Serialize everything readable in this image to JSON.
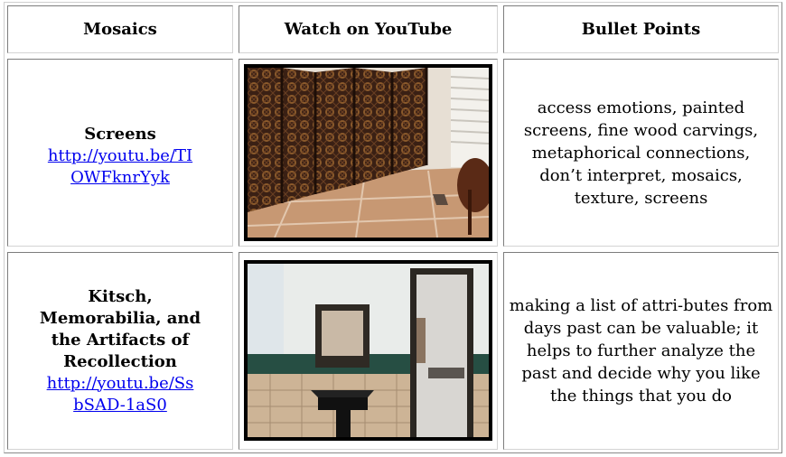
{
  "headers": {
    "col1": "Mosaics",
    "col2": "Watch on YouTube",
    "col3": "Bullet Points"
  },
  "rows": [
    {
      "title": "Screens",
      "link_line1": "http://youtu.be/TI",
      "link_line2": "OWFknrYyk",
      "bullets": "access emotions, painted screens, fine wood carvings, metaphorical connections, don’t interpret, mosaics, texture, screens"
    },
    {
      "title_line1": "Kitsch,",
      "title_line2": "Memorabilia, and",
      "title_line3": "the Artifacts of",
      "title_line4": "Recollection",
      "link_line1": "http://youtu.be/Ss",
      "link_line2": "bSAD-1aS0",
      "bullets": "making a list of attri-butes from days past can be valuable; it helps to further analyze the past and decide why you like the things that you do"
    }
  ]
}
